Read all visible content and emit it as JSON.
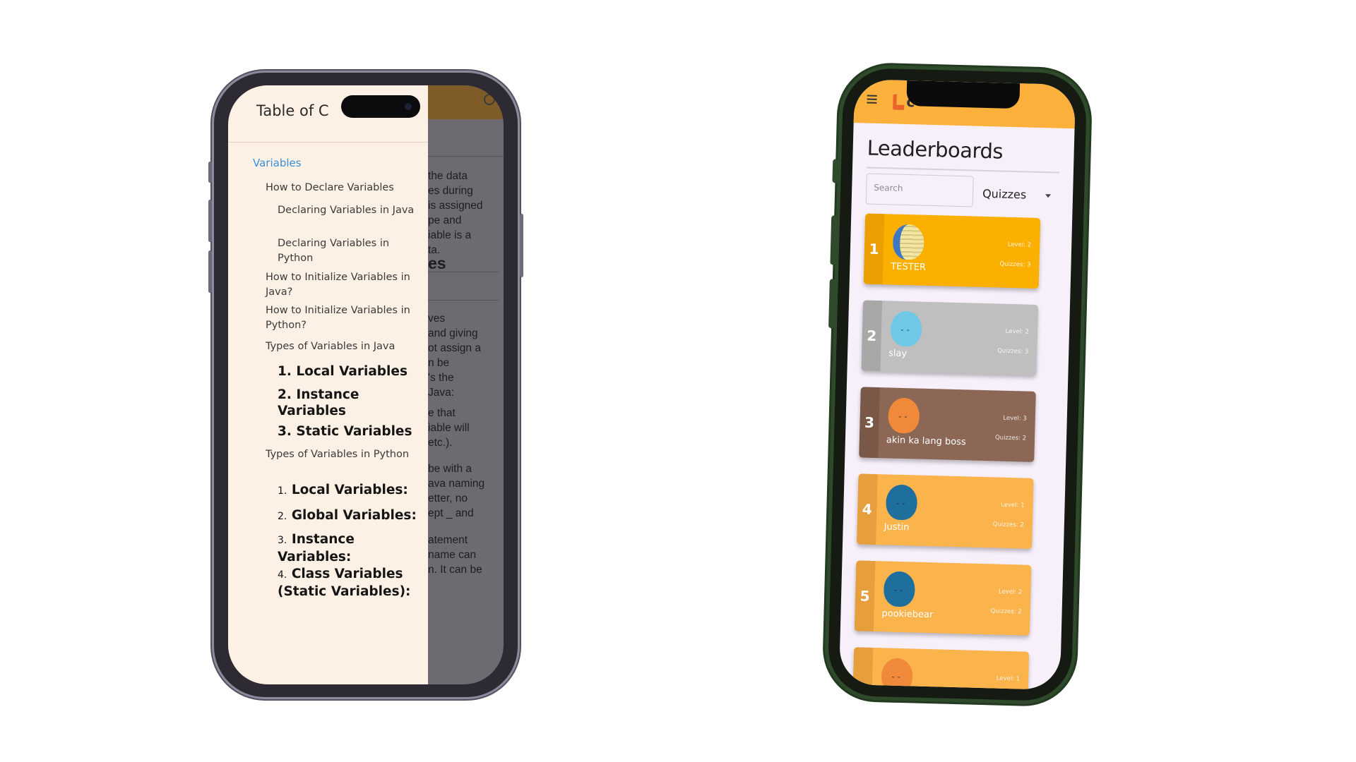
{
  "phone_left": {
    "drawer": {
      "title": "Table of C",
      "items": [
        {
          "label": "Variables",
          "level": 0
        },
        {
          "label": "How to Declare Variables",
          "level": 1
        },
        {
          "label": "Declaring Variables in Java",
          "level": 2
        },
        {
          "label": "Declaring Variables in Python",
          "level": 2
        },
        {
          "label": "How to Initialize Variables in Java?",
          "level": 1
        },
        {
          "label": "How to Initialize Variables in Python?",
          "level": 1
        },
        {
          "label": "Types of Variables in Java",
          "level": 1
        },
        {
          "label": "1. Local Variables",
          "level": 3
        },
        {
          "label": "2. Instance Variables",
          "level": 3
        },
        {
          "label": "3. Static Variables",
          "level": 3
        },
        {
          "label": "Types of Variables in Python",
          "level": 1
        },
        {
          "num": "1.",
          "label": "Local Variables:",
          "level": 3
        },
        {
          "num": "2.",
          "label": "Global Variables:",
          "level": 3
        },
        {
          "num": "3.",
          "label": "Instance Variables:",
          "level": 3
        },
        {
          "num": "4.",
          "label": "Class Variables (Static Variables):",
          "level": 3
        }
      ]
    },
    "background_text": {
      "p1": "the data\nes during\nis assigned\npe and\niable is a\nta.",
      "h1": "es",
      "p2": "ves\nand giving\not assign a\nn be\n's the\nJava:",
      "p3": "e that\niable will\netc.).",
      "p4": "be with a\nava naming\netter, no\nept _ and",
      "p5": "atement\nname can\nn. It can be"
    }
  },
  "phone_right": {
    "header": {
      "logo_text": "c"
    },
    "title": "Leaderboards",
    "search": {
      "placeholder": "Search"
    },
    "filter": {
      "selected": "Quizzes"
    },
    "entries": [
      {
        "rank": "1",
        "name": "TESTER",
        "level": "Level: 2",
        "quizzes": "Quizzes: 3",
        "card_color": "#fbb000",
        "strip_color": "#ec9f00",
        "avatar": "image"
      },
      {
        "rank": "2",
        "name": "slay",
        "level": "Level: 2",
        "quizzes": "Quizzes: 3",
        "card_color": "#bfbfbf",
        "strip_color": "#a8a8a8",
        "avatar_color": "#6fc8e6"
      },
      {
        "rank": "3",
        "name": "akin ka lang boss",
        "level": "Level: 3",
        "quizzes": "Quizzes: 2",
        "card_color": "#8c6756",
        "strip_color": "#7a5848",
        "avatar_color": "#f08a3a"
      },
      {
        "rank": "4",
        "name": "Justin",
        "level": "Level: 1",
        "quizzes": "Quizzes: 2",
        "card_color": "#fbb34c",
        "strip_color": "#e69f3c",
        "avatar_color": "#1f6f9e"
      },
      {
        "rank": "5",
        "name": "pookiebear",
        "level": "Level: 2",
        "quizzes": "Quizzes: 2",
        "card_color": "#fbb34c",
        "strip_color": "#e69f3c",
        "avatar_color": "#1f6f9e"
      },
      {
        "rank": "",
        "name": "",
        "level": "Level: 1",
        "quizzes": "",
        "card_color": "#fbb34c",
        "strip_color": "#e69f3c",
        "avatar_color": "#f08a3a"
      }
    ]
  }
}
